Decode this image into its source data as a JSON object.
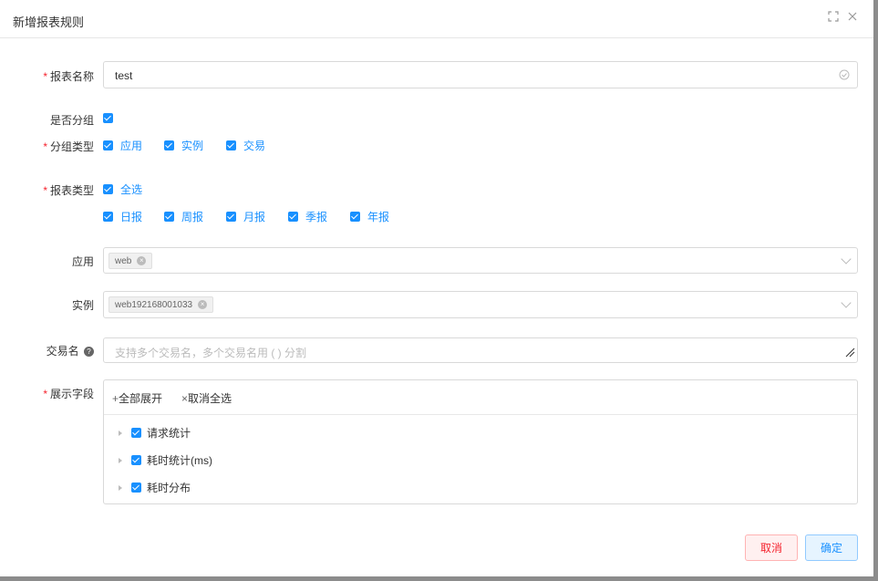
{
  "dialog": {
    "title": "新增报表规则"
  },
  "form": {
    "report_name": {
      "label": "报表名称",
      "value": "test"
    },
    "is_group": {
      "label": "是否分组"
    },
    "group_type": {
      "label": "分组类型",
      "options": [
        "应用",
        "实例",
        "交易"
      ]
    },
    "report_type": {
      "label": "报表类型",
      "select_all": "全选",
      "options": [
        "日报",
        "周报",
        "月报",
        "季报",
        "年报"
      ]
    },
    "app": {
      "label": "应用",
      "tags": [
        "web"
      ]
    },
    "instance": {
      "label": "实例",
      "tags": [
        "web192168001033"
      ]
    },
    "transaction": {
      "label": "交易名",
      "placeholder": "支持多个交易名，多个交易名用 ( ) 分割"
    },
    "display_fields": {
      "label": "展示字段",
      "expand_all": "全部展开",
      "deselect_all": "取消全选",
      "items": [
        "请求统计",
        "耗时统计(ms)",
        "耗时分布"
      ]
    }
  },
  "footer": {
    "cancel": "取消",
    "confirm": "确定"
  },
  "colors": {
    "accent": "#1890ff",
    "danger": "#f5222d"
  }
}
